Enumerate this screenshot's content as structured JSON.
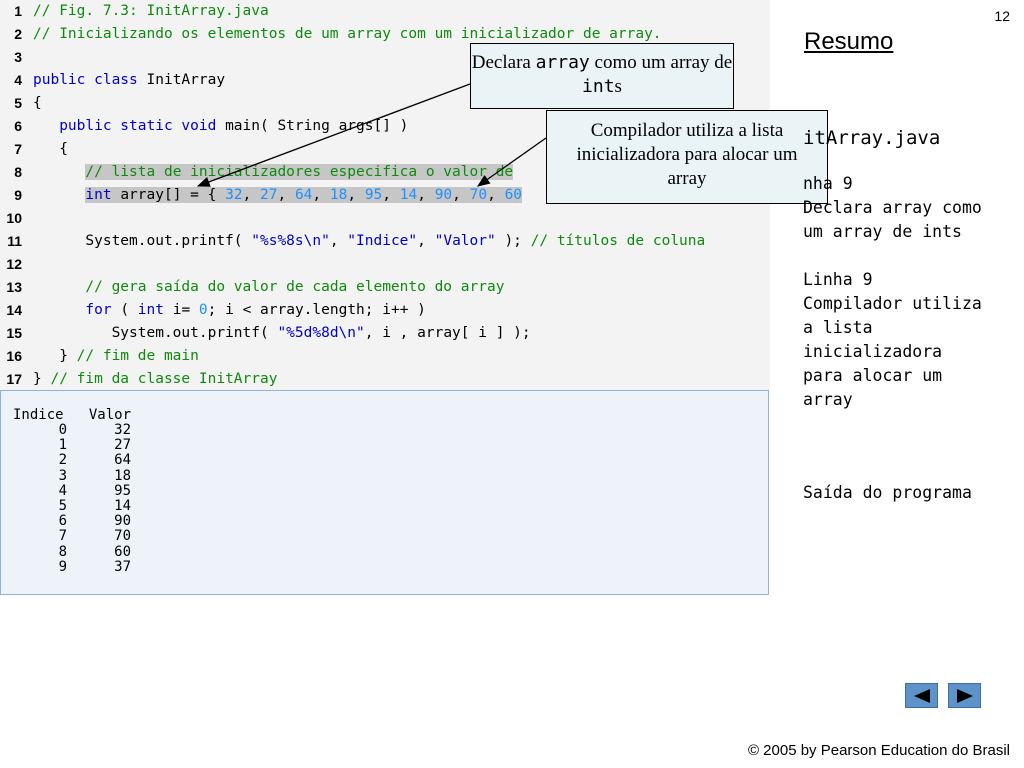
{
  "slide": {
    "number": "12",
    "summary_title": "Resumo",
    "copyright": "© 2005 by Pearson Education do Brasil"
  },
  "code_lines": [
    {
      "n": "1",
      "tokens": [
        {
          "t": "comment",
          "s": "// Fig. 7.3: InitArray.java"
        }
      ]
    },
    {
      "n": "2",
      "tokens": [
        {
          "t": "comment",
          "s": "// Inicializando os elementos de um array com um inicializador de array."
        }
      ]
    },
    {
      "n": "3",
      "tokens": []
    },
    {
      "n": "4",
      "tokens": [
        {
          "t": "keyword",
          "s": "public class "
        },
        {
          "t": "plain",
          "s": "InitArray"
        }
      ]
    },
    {
      "n": "5",
      "tokens": [
        {
          "t": "plain",
          "s": "{"
        }
      ]
    },
    {
      "n": "6",
      "tokens": [
        {
          "t": "plain",
          "s": "   "
        },
        {
          "t": "keyword",
          "s": "public static void "
        },
        {
          "t": "plain",
          "s": "main( String args[] )"
        }
      ]
    },
    {
      "n": "7",
      "tokens": [
        {
          "t": "plain",
          "s": "   {"
        }
      ]
    },
    {
      "n": "8",
      "indent": "      ",
      "hl": true,
      "tokens": [
        {
          "t": "comment",
          "s": "// lista de inicializadores especifica o valor de"
        }
      ]
    },
    {
      "n": "9",
      "indent": "      ",
      "hl": true,
      "tokens": [
        {
          "t": "keyword",
          "s": "int "
        },
        {
          "t": "plain",
          "s": "array[] = { "
        },
        {
          "t": "number",
          "s": "32"
        },
        {
          "t": "plain",
          "s": ", "
        },
        {
          "t": "number",
          "s": "27"
        },
        {
          "t": "plain",
          "s": ", "
        },
        {
          "t": "number",
          "s": "64"
        },
        {
          "t": "plain",
          "s": ", "
        },
        {
          "t": "number",
          "s": "18"
        },
        {
          "t": "plain",
          "s": ", "
        },
        {
          "t": "number",
          "s": "95"
        },
        {
          "t": "plain",
          "s": ", "
        },
        {
          "t": "number",
          "s": "14"
        },
        {
          "t": "plain",
          "s": ", "
        },
        {
          "t": "number",
          "s": "90"
        },
        {
          "t": "plain",
          "s": ", "
        },
        {
          "t": "number",
          "s": "70"
        },
        {
          "t": "plain",
          "s": ", "
        },
        {
          "t": "number",
          "s": "60"
        }
      ]
    },
    {
      "n": "10",
      "tokens": []
    },
    {
      "n": "11",
      "tokens": [
        {
          "t": "plain",
          "s": "      System.out.printf( "
        },
        {
          "t": "string",
          "s": "\"%s%8s\\n\""
        },
        {
          "t": "plain",
          "s": ", "
        },
        {
          "t": "string",
          "s": "\"Indice\""
        },
        {
          "t": "plain",
          "s": ", "
        },
        {
          "t": "string",
          "s": "\"Valor\""
        },
        {
          "t": "plain",
          "s": " ); "
        },
        {
          "t": "comment",
          "s": "// títulos de coluna"
        }
      ]
    },
    {
      "n": "12",
      "tokens": []
    },
    {
      "n": "13",
      "tokens": [
        {
          "t": "plain",
          "s": "      "
        },
        {
          "t": "comment",
          "s": "// gera saída do valor de cada elemento do array"
        }
      ]
    },
    {
      "n": "14",
      "tokens": [
        {
          "t": "plain",
          "s": "      "
        },
        {
          "t": "keyword",
          "s": "for"
        },
        {
          "t": "plain",
          "s": " ( "
        },
        {
          "t": "keyword",
          "s": "int"
        },
        {
          "t": "plain",
          "s": " i= "
        },
        {
          "t": "number",
          "s": "0"
        },
        {
          "t": "plain",
          "s": "; i < array.length; i++ )"
        }
      ]
    },
    {
      "n": "15",
      "tokens": [
        {
          "t": "plain",
          "s": "         System.out.printf( "
        },
        {
          "t": "string",
          "s": "\"%5d%8d\\n\""
        },
        {
          "t": "plain",
          "s": ", i , array[ i ] );"
        }
      ]
    },
    {
      "n": "16",
      "tokens": [
        {
          "t": "plain",
          "s": "   } "
        },
        {
          "t": "comment",
          "s": "// fim de main"
        }
      ]
    },
    {
      "n": "17",
      "tokens": [
        {
          "t": "plain",
          "s": "} "
        },
        {
          "t": "comment",
          "s": "// fim da classe InitArray"
        }
      ]
    }
  ],
  "output": {
    "header": "Indice   Valor",
    "rows": [
      {
        "index": "0",
        "value": "32"
      },
      {
        "index": "1",
        "value": "27"
      },
      {
        "index": "2",
        "value": "64"
      },
      {
        "index": "3",
        "value": "18"
      },
      {
        "index": "4",
        "value": "95"
      },
      {
        "index": "5",
        "value": "14"
      },
      {
        "index": "6",
        "value": "90"
      },
      {
        "index": "7",
        "value": "70"
      },
      {
        "index": "8",
        "value": "60"
      },
      {
        "index": "9",
        "value": "37"
      }
    ]
  },
  "callouts": {
    "declare": {
      "pre": "Declara ",
      "code1": "array",
      "mid": " como um array de ",
      "code2": "int",
      "post": "s"
    },
    "compiler": {
      "text": "Compilador utiliza a lista inicializadora para alocar um array"
    }
  },
  "sidebar": {
    "file": "itArray.java",
    "line9a_label": "nha 9",
    "line9a_text": "Declara array como\num array de ints",
    "line9b_label": "Linha 9",
    "line9b_text": "Compilador utiliza\na lista\ninicializadora\npara alocar um\narray",
    "output_label": "Saída do programa"
  },
  "nav": {
    "prev_icon": "triangle-left",
    "next_icon": "triangle-right",
    "color": "#5e93c9"
  },
  "colors": {
    "comment": "#0f8a0f",
    "keyword": "#0000c8",
    "number": "#1e90ff",
    "callout_bg": "#eaf3f5",
    "output_bg": "#eef3fa"
  }
}
